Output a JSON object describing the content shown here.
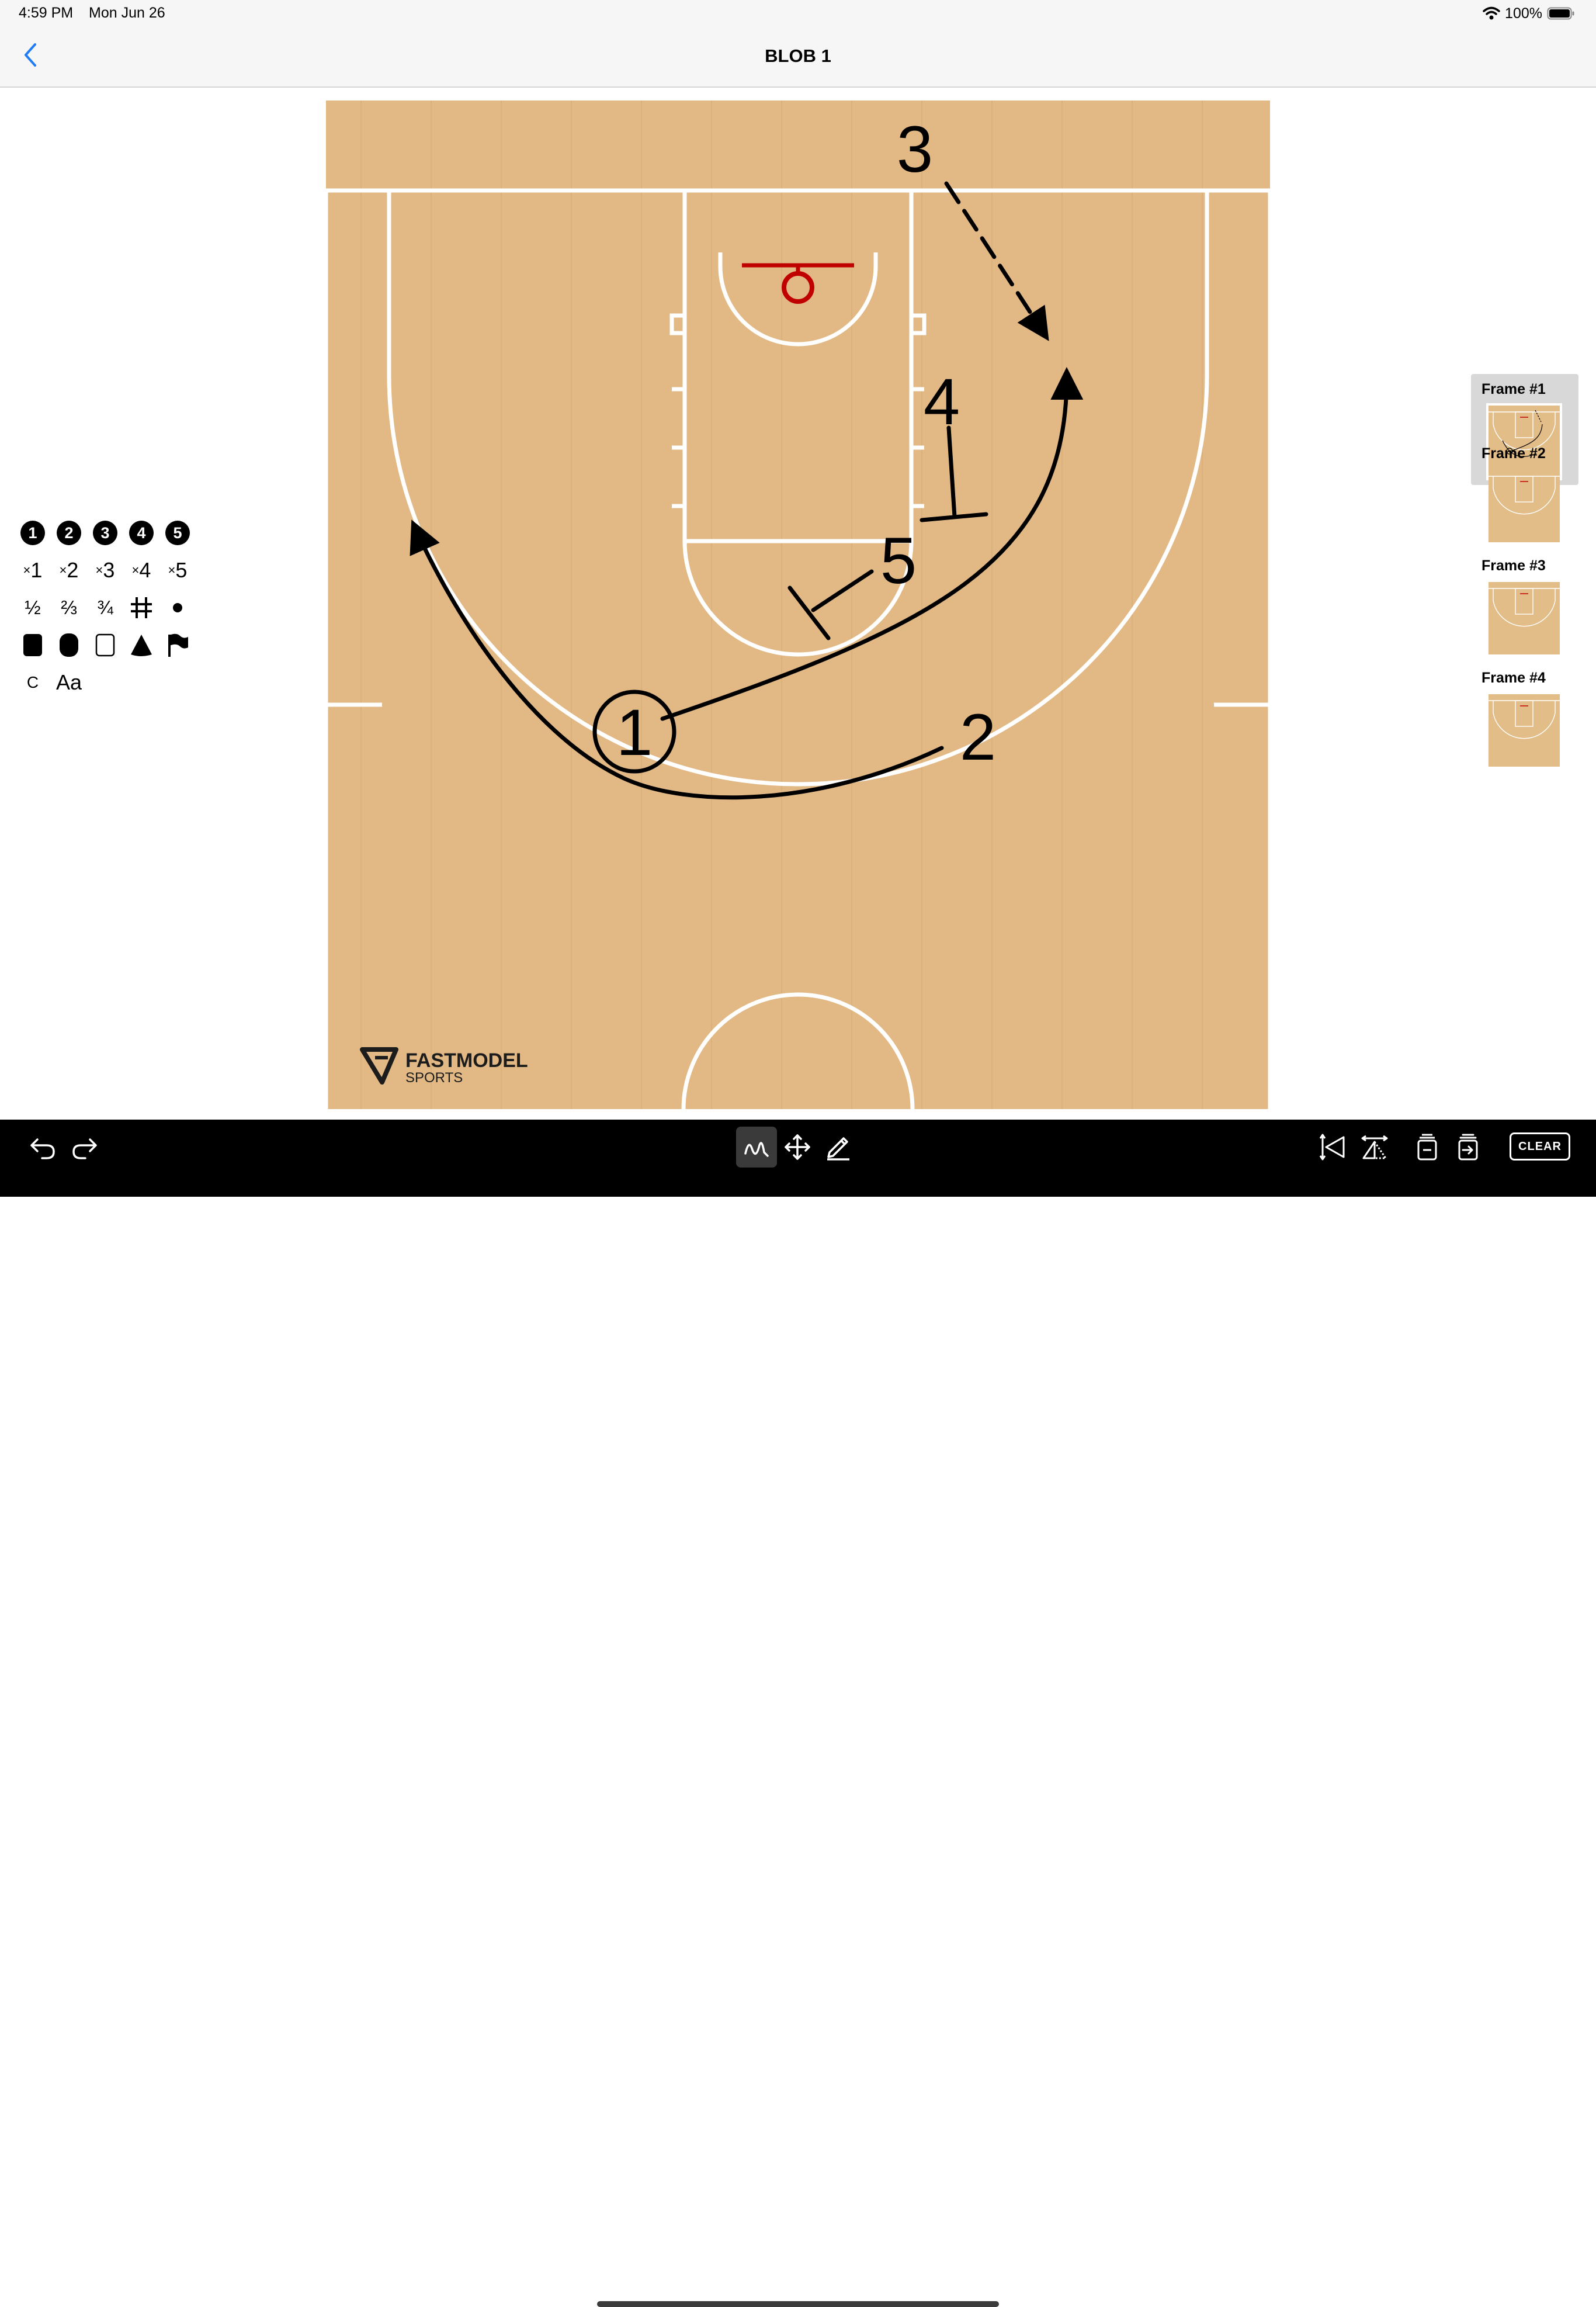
{
  "status_bar": {
    "time": "4:59 PM",
    "date": "Mon Jun 26",
    "battery": "100%"
  },
  "nav": {
    "title": "BLOB 1",
    "back_icon": "chevron-left-icon"
  },
  "court": {
    "labels": {
      "p1": "1",
      "p2": "2",
      "p3": "3",
      "p4": "4",
      "p5": "5"
    },
    "logo_line1": "FASTMODEL",
    "logo_line2": "SPORTS",
    "colors": {
      "floor": "#e2b985",
      "lines": "#ffffff",
      "rim": "#c00000",
      "ink": "#000000"
    }
  },
  "palette": {
    "players": [
      "1",
      "2",
      "3",
      "4",
      "5"
    ],
    "defenders": [
      "1",
      "2",
      "3",
      "4",
      "5"
    ],
    "defender_prefix": "×",
    "fractions": [
      "½",
      "⅔",
      "¾"
    ],
    "row4_icons": [
      "screen-icon",
      "ball-dot-icon"
    ],
    "row5_icons": [
      "square-filled-icon",
      "rounded-rect-icon",
      "square-outline-icon",
      "cone-icon",
      "flag-icon"
    ],
    "coach": "C",
    "text_tool": "Aa"
  },
  "frames": [
    {
      "label": "Frame #1",
      "selected": true
    },
    {
      "label": "Frame #2",
      "selected": false
    },
    {
      "label": "Frame #3",
      "selected": false
    },
    {
      "label": "Frame #4",
      "selected": false
    }
  ],
  "toolbar": {
    "left_icons": [
      "undo-icon",
      "redo-icon"
    ],
    "center_icons": [
      "draw-icon",
      "move-icon",
      "pencil-icon"
    ],
    "right_icons": [
      "flip-vertical-icon",
      "flip-horizontal-icon",
      "delete-frame-icon",
      "next-frame-icon"
    ],
    "clear_label": "CLEAR"
  }
}
